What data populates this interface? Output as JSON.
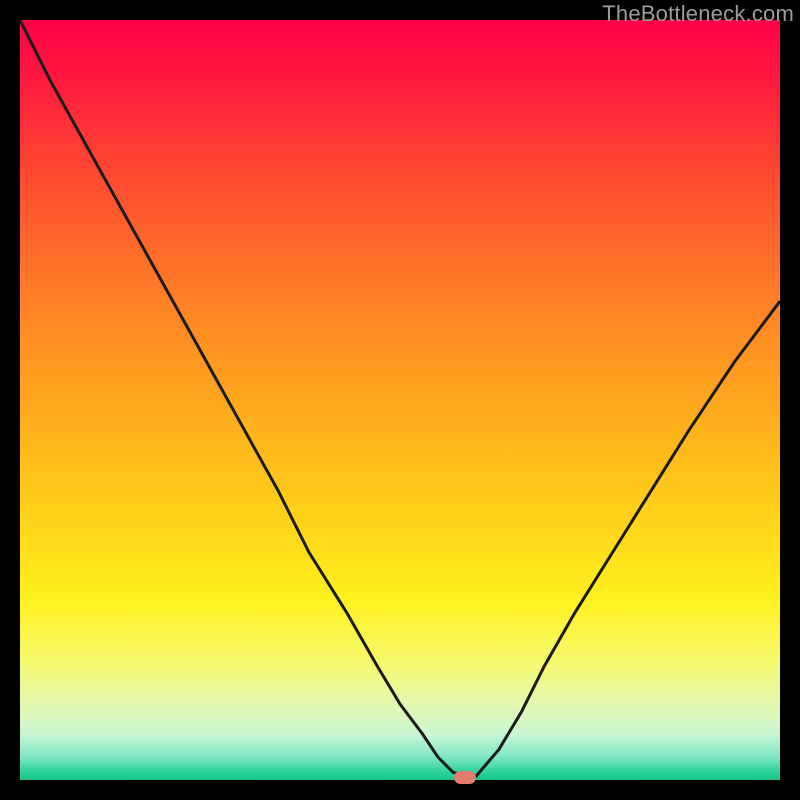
{
  "watermark": "TheBottleneck.com",
  "colors": {
    "frame": "#000000",
    "curve_stroke": "#1b1b1b",
    "marker_fill": "#e17b6a",
    "watermark_text": "#9c9c9c"
  },
  "chart_data": {
    "type": "line",
    "title": "",
    "xlabel": "",
    "ylabel": "",
    "xlim": [
      0,
      100
    ],
    "ylim": [
      0,
      100
    ],
    "grid": false,
    "legend": false,
    "note": "Axes are unlabeled; x/y treated as 0–100 percent of the plot area. y is the curve height measured upward from the bottom green band.",
    "series": [
      {
        "name": "bottleneck-curve",
        "x": [
          0,
          4,
          9,
          14,
          19,
          24,
          29,
          34,
          38,
          43,
          47,
          50,
          53,
          55,
          57,
          59,
          60,
          63,
          66,
          69,
          73,
          78,
          83,
          88,
          94,
          100
        ],
        "y": [
          100,
          92,
          83,
          74,
          65,
          56,
          47,
          38,
          30,
          22,
          15,
          10,
          6,
          3,
          1,
          0.5,
          0.5,
          4,
          9,
          15,
          22,
          30,
          38,
          46,
          55,
          63
        ]
      }
    ],
    "marker": {
      "name": "minimum-point",
      "x": 58.5,
      "y": 0.0
    },
    "background_gradient_stops": [
      {
        "pos": 0.0,
        "color": "#ff0046"
      },
      {
        "pos": 0.3,
        "color": "#ff6a2a"
      },
      {
        "pos": 0.66,
        "color": "#ffd419"
      },
      {
        "pos": 0.84,
        "color": "#f7fa68"
      },
      {
        "pos": 0.97,
        "color": "#7ee7c5"
      },
      {
        "pos": 1.0,
        "color": "#1bc28e"
      }
    ]
  }
}
